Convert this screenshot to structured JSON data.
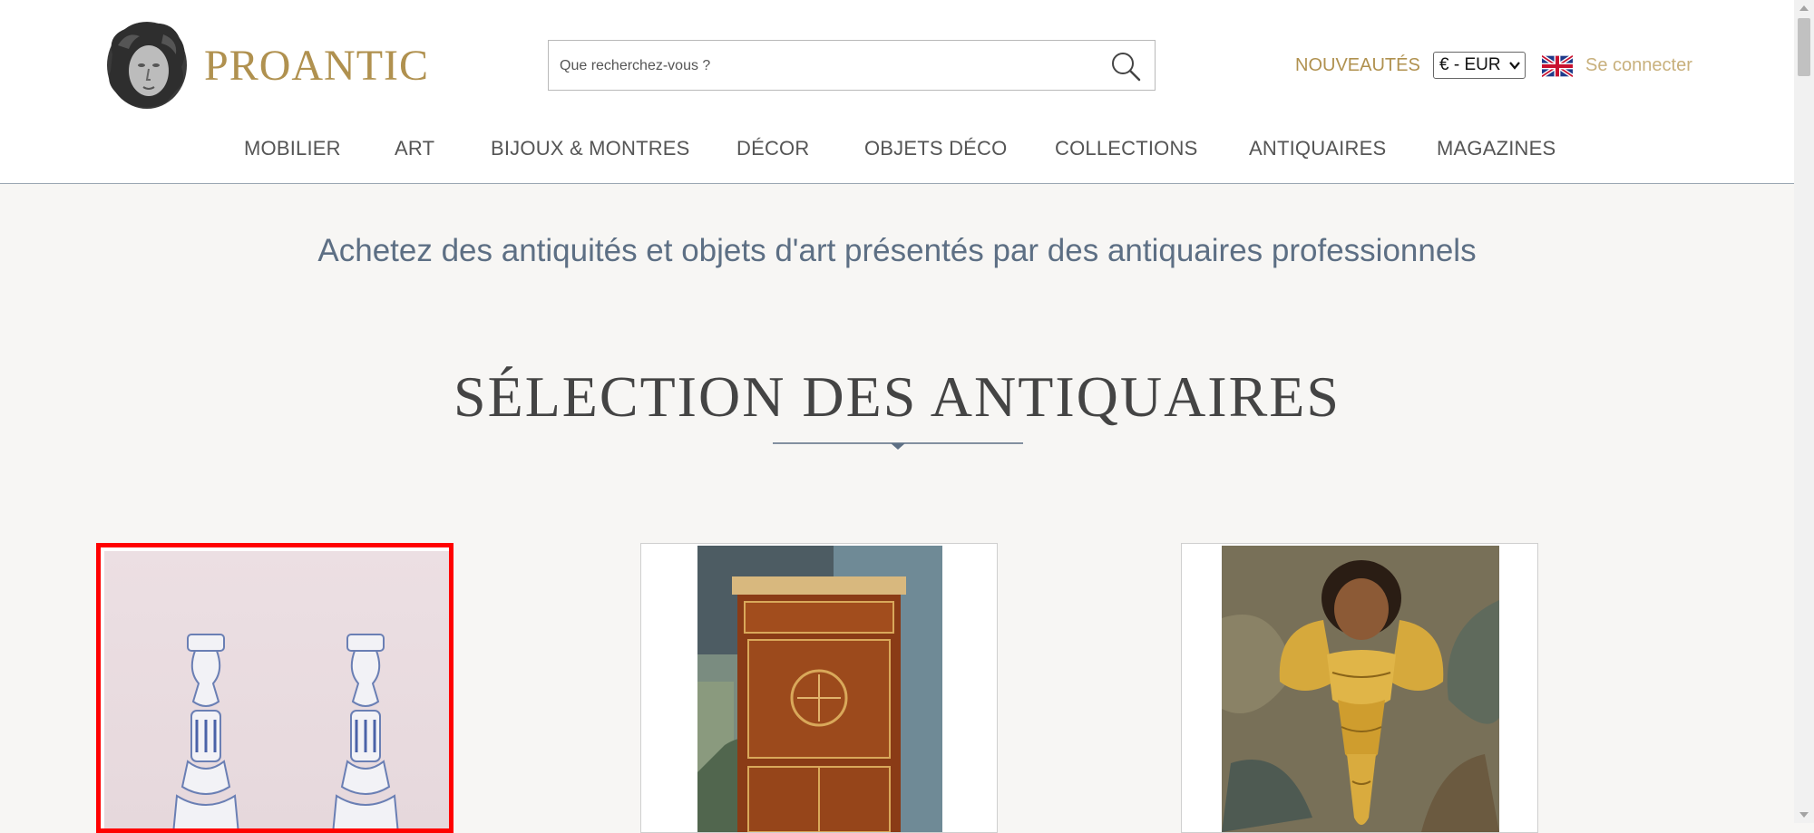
{
  "header": {
    "brand": "PROANTIC",
    "search_placeholder": "Que recherchez-vous ?",
    "nouveautes": "NOUVEAUTÉS",
    "currency": "€ - EUR",
    "login": "Se connecter"
  },
  "nav": [
    "MOBILIER",
    "ART",
    "BIJOUX & MONTRES",
    "DÉCOR",
    "OBJETS DÉCO",
    "COLLECTIONS",
    "ANTIQUAIRES",
    "MAGAZINES"
  ],
  "main": {
    "tagline": "Achetez des antiquités et objets d'art présentés par des antiquaires professionnels",
    "section_title": "SÉLECTION DES ANTIQUAIRES"
  },
  "colors": {
    "brand_gold": "#b0914f",
    "header_bg": "#ffffff",
    "page_bg": "#f7f6f4",
    "tagline_blue": "#5d6f84",
    "selection_red": "#ff0000"
  },
  "icons": {
    "search": "search-icon",
    "flag": "uk-flag-icon",
    "logo": "bust-logo-icon"
  }
}
